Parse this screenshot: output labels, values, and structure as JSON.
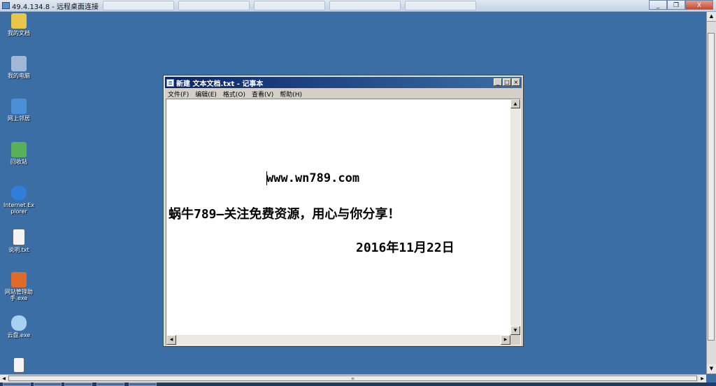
{
  "rdp": {
    "title": "49.4.134.8 - 远程桌面连接",
    "controls": {
      "minimize": "_",
      "restore": "❐",
      "close": "X"
    }
  },
  "desktop_icons": [
    {
      "name": "my-documents",
      "label": "我的文档",
      "color": "#e8c64a"
    },
    {
      "name": "my-computer",
      "label": "我的电脑",
      "color": "#9fb8d8"
    },
    {
      "name": "network-places",
      "label": "网上邻居",
      "color": "#4a8fd8"
    },
    {
      "name": "recycle-bin",
      "label": "回收站",
      "color": "#58b058"
    },
    {
      "name": "internet-explorer",
      "label": "Internet Explorer",
      "color": "#2f7ed8"
    },
    {
      "name": "readme-txt",
      "label": "说明.txt",
      "color": "#f4f4f4"
    },
    {
      "name": "site-manager",
      "label": "网站管理助手.exe",
      "color": "#e06a2a"
    },
    {
      "name": "cloud-disk",
      "label": "云盘.exe",
      "color": "#a8d0f0"
    },
    {
      "name": "file-unnamed",
      "label": "",
      "color": "#f4f4f4"
    }
  ],
  "notepad": {
    "title": "新建 文本文档.txt - 记事本",
    "menu": [
      "文件(F)",
      "编辑(E)",
      "格式(O)",
      "查看(V)",
      "帮助(H)"
    ],
    "lines": [
      "www.wn789.com",
      "蜗牛789—关注免费资源，用心与你分享！",
      "2016年11月22日"
    ]
  },
  "scrollbar": {
    "grip": "≡"
  }
}
